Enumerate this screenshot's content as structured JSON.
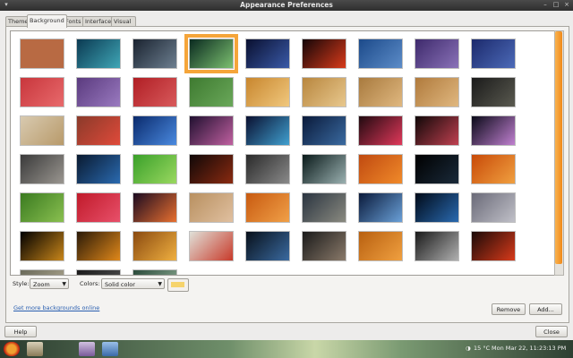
{
  "window": {
    "title": "Appearance Preferences"
  },
  "tabs": [
    "Theme",
    "Background",
    "Fonts",
    "Interface",
    "Visual Effects"
  ],
  "colors": {
    "accent": "#f5a53a",
    "swatch": "#f6d36b",
    "link": "#2a5fb0"
  },
  "options": {
    "style_label": "Style:",
    "style_value": "Zoom",
    "colors_label": "Colors:",
    "colors_value": "Solid color"
  },
  "links": {
    "more_backgrounds": "Get more backgrounds online"
  },
  "buttons": {
    "remove": "Remove",
    "add": "Add...",
    "help": "Help",
    "close": "Close"
  },
  "taskbar": {
    "weather": "15 °C",
    "clock": "Mon Mar 22, 11:23:13 PM"
  },
  "wallpapers": [
    [
      "#b86a43",
      "#b86a43"
    ],
    [
      "#0b3a52",
      "#3fa6b6"
    ],
    [
      "#1a2330",
      "#6d7f90"
    ],
    [
      "#0a2a20",
      "#7cc070"
    ],
    [
      "#0a1030",
      "#3a5aa8"
    ],
    [
      "#140608",
      "#d83a1a"
    ],
    [
      "#1c4a8a",
      "#5c8cc8"
    ],
    [
      "#3e2a6c",
      "#8a72b8"
    ],
    [
      "#1c2a6c",
      "#4c6ab8"
    ],
    [
      "#c8363c",
      "#e86a6c"
    ],
    [
      "#5a3a7e",
      "#9a7ac0"
    ],
    [
      "#b01e24",
      "#d85a5c"
    ],
    [
      "#3e7a30",
      "#6aa85a"
    ],
    [
      "#c8862e",
      "#f0c87e"
    ],
    [
      "#b8863e",
      "#e8c88e"
    ],
    [
      "#a87a3e",
      "#e0b880"
    ],
    [
      "#b07a3c",
      "#e0b880"
    ],
    [
      "#1a1a1a",
      "#5a5a50"
    ],
    [
      "#d8cab0",
      "#b89a6a"
    ],
    [
      "#8a3a2a",
      "#e04a3a"
    ],
    [
      "#0a2a6c",
      "#4a8ae0"
    ],
    [
      "#201030",
      "#c060a0"
    ],
    [
      "#0a1030",
      "#40a0d0"
    ],
    [
      "#0a1a3a",
      "#3a6aa0"
    ],
    [
      "#200a10",
      "#e0385a"
    ],
    [
      "#100808",
      "#c04050"
    ],
    [
      "#0a0a18",
      "#c080d0"
    ],
    [
      "#3a3a3a",
      "#9a9690"
    ],
    [
      "#0a1a30",
      "#2a6ab0"
    ],
    [
      "#3aa02a",
      "#9ad860"
    ],
    [
      "#100808",
      "#8a2a10"
    ],
    [
      "#2a2a2a",
      "#8a8a8a"
    ],
    [
      "#0a1a1a",
      "#9ab0b0"
    ],
    [
      "#c04a10",
      "#f08a2a"
    ],
    [
      "#000000",
      "#1a2a3a"
    ],
    [
      "#c84a08",
      "#f0a040"
    ],
    [
      "#3a7a20",
      "#8ac050"
    ],
    [
      "#c01a2a",
      "#e8506a"
    ],
    [
      "#1a0a20",
      "#e87030"
    ],
    [
      "#b89060",
      "#e0c0a0"
    ],
    [
      "#c85a10",
      "#f0a048"
    ],
    [
      "#2a3440",
      "#8a8a80"
    ],
    [
      "#0a1a3a",
      "#6aa0d8"
    ],
    [
      "#000a18",
      "#2a6ab0"
    ],
    [
      "#6a6a78",
      "#c0c0c8"
    ],
    [
      "#000000",
      "#c8861a"
    ],
    [
      "#2a1a08",
      "#e0881a"
    ],
    [
      "#8a4a10",
      "#f0b040"
    ],
    [
      "#e0e0d8",
      "#c83a2a"
    ],
    [
      "#08101a",
      "#3a6aa0"
    ],
    [
      "#1a1a1a",
      "#8a7a6a"
    ],
    [
      "#b86010",
      "#f0a040"
    ],
    [
      "#1a1a1a",
      "#b0b0b0"
    ],
    [
      "#1a0a08",
      "#d83a1a"
    ],
    [
      "#6a6a5a",
      "#b8b098"
    ],
    [
      "#1a1a1a",
      "#5a5a5a"
    ],
    [
      "#2a4a3a",
      "#9ab8a0"
    ]
  ]
}
